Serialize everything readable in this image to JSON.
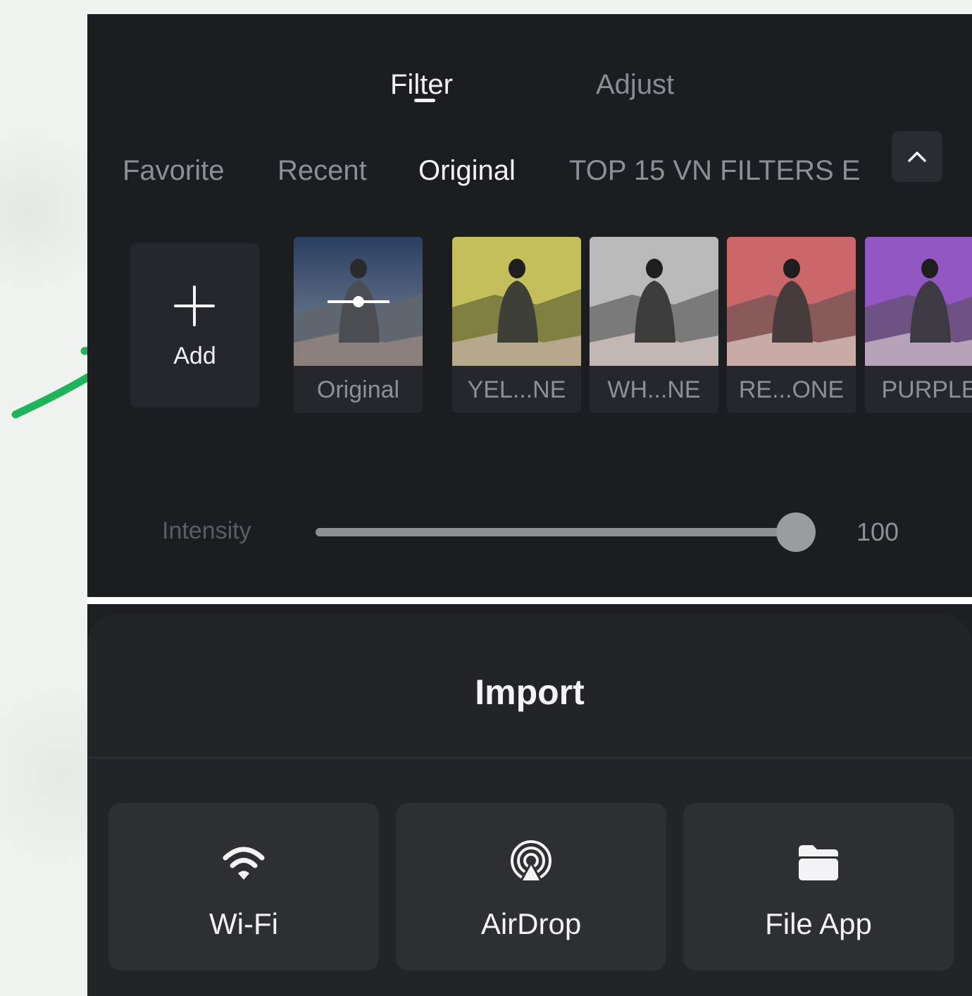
{
  "tabs": {
    "filter": "Filter",
    "adjust": "Adjust",
    "active": "Filter"
  },
  "categories": {
    "favorite": "Favorite",
    "recent": "Recent",
    "original": "Original",
    "top": "TOP 15 VN FILTERS E",
    "active": "Original",
    "collapse_icon": "chevron-up-icon"
  },
  "add_tile": {
    "label": "Add",
    "icon": "plus-icon"
  },
  "presets": [
    {
      "label": "Original",
      "tint": "#2a3f62"
    },
    {
      "label": "YEL...NE",
      "tint": "#b9b44a"
    },
    {
      "label": "WH...NE",
      "tint": "#a9a9a9"
    },
    {
      "label": "RE...ONE",
      "tint": "#c0585c"
    },
    {
      "label": "PURPLE",
      "tint": "#8b4fbd"
    }
  ],
  "intensity": {
    "label": "Intensity",
    "value": "100",
    "fraction": 1.0
  },
  "import": {
    "title": "Import",
    "sources": [
      {
        "label": "Wi-Fi",
        "icon": "wifi-icon"
      },
      {
        "label": "AirDrop",
        "icon": "airdrop-icon"
      },
      {
        "label": "File App",
        "icon": "folder-icon"
      }
    ]
  },
  "annotation": {
    "arrow_color": "#1fb35a",
    "target": "Add"
  }
}
